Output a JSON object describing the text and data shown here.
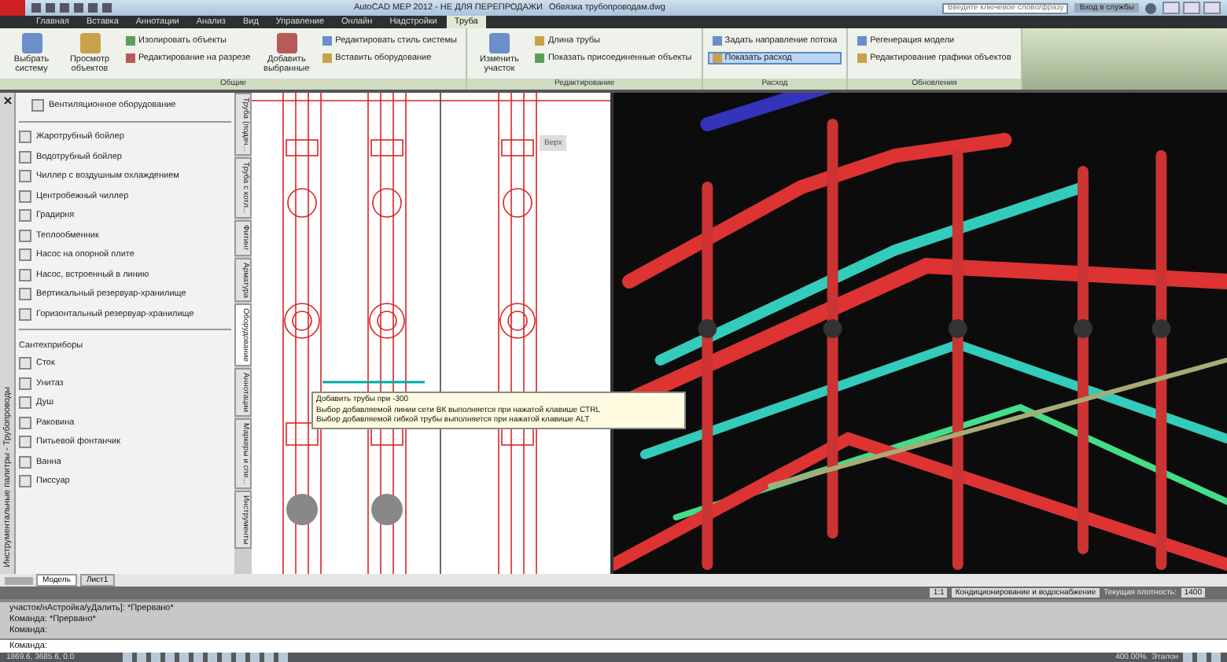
{
  "window": {
    "app_title": "AutoCAD MEP 2012 - НЕ ДЛЯ ПЕРЕПРОДАЖИ",
    "file_title": "Обвязка трубопроводам.dwg",
    "search": {
      "placeholder": "Введите ключевое слово/фразу"
    },
    "sign_in": "Вход в службы"
  },
  "tabs": [
    {
      "label": "Главная",
      "selected": false
    },
    {
      "label": "Вставка",
      "selected": false
    },
    {
      "label": "Аннотации",
      "selected": false
    },
    {
      "label": "Анализ",
      "selected": false
    },
    {
      "label": "Вид",
      "selected": false
    },
    {
      "label": "Управление",
      "selected": false
    },
    {
      "label": "Онлайн",
      "selected": false
    },
    {
      "label": "Надстройки",
      "selected": false
    },
    {
      "label": "Труба",
      "selected": true
    }
  ],
  "ribbon": {
    "panels": [
      {
        "title": "Общие",
        "groups": [
          {
            "kind": "large",
            "label": "Выбрать систему"
          },
          {
            "kind": "large",
            "label": "Просмотр объектов"
          },
          {
            "kind": "stack",
            "items": [
              {
                "label": "Изолировать объекты",
                "selected": false
              },
              {
                "label": "Редактирование на разрезе",
                "selected": false
              }
            ]
          },
          {
            "kind": "large",
            "label": "Добавить выбранные"
          },
          {
            "kind": "stack",
            "items": [
              {
                "label": "Редактировать стиль системы",
                "selected": false
              },
              {
                "label": "Вставить оборудование",
                "selected": false
              }
            ]
          }
        ]
      },
      {
        "title": "Редактирование",
        "groups": [
          {
            "kind": "large",
            "label": "Изменить участок"
          },
          {
            "kind": "stack",
            "items": [
              {
                "label": "Длина трубы",
                "selected": false
              },
              {
                "label": "Показать присоединенные объекты",
                "selected": false
              }
            ]
          }
        ]
      },
      {
        "title": "Расход",
        "groups": [
          {
            "kind": "stack",
            "items": [
              {
                "label": "Задать направление потока",
                "selected": false
              },
              {
                "label": "Показать расход",
                "selected": true
              }
            ]
          }
        ]
      },
      {
        "title": "Обновления",
        "groups": [
          {
            "kind": "stack",
            "items": [
              {
                "label": "Регенерация модели",
                "selected": false
              },
              {
                "label": "Редактирование графики объектов",
                "selected": false
              }
            ]
          }
        ]
      }
    ]
  },
  "palette": {
    "title": "Инструментальные палитры - Трубопроводы",
    "header_item": "Вентиляционное оборудование",
    "equipment": [
      "Жаротрубный бойлер",
      "Водотрубный бойлер",
      "Чиллер с воздушным охлаждением",
      "Центробежный чиллер",
      "Градирня",
      "Теплообменник",
      "Насос на опорной плите",
      "Насос, встроенный в линию",
      "Вертикальный резервуар-хранилище",
      "Горизонтальный резервуар-хранилище"
    ],
    "section_title": "Сантехприборы",
    "fixtures": [
      "Сток",
      "Унитаз",
      "Душ",
      "Раковина",
      "Питьевой фонтанчик",
      "Ванна",
      "Писсуар"
    ],
    "tabs": [
      {
        "label": "Труба (подач...",
        "selected": false
      },
      {
        "label": "Труба с котл...",
        "selected": false
      },
      {
        "label": "Фитинг",
        "selected": false
      },
      {
        "label": "Арматура",
        "selected": false
      },
      {
        "label": "Оборудование",
        "selected": true
      },
      {
        "label": "Аннотации",
        "selected": false
      },
      {
        "label": "Маркеры и спе...",
        "selected": false
      },
      {
        "label": "Инструменты",
        "selected": false
      }
    ]
  },
  "viewport": {
    "view_label": "Верх",
    "tooltip": [
      "Добавить трубы при -300",
      "Выбор добавляемой линии сети ВК выполняется при нажатой клавише CTRL",
      "Выбор добавляемой гибкой трубы выполняется при нажатой клавише ALT"
    ]
  },
  "layout_tabs": [
    {
      "label": "Модель",
      "selected": true
    },
    {
      "label": "Лист1",
      "selected": false
    }
  ],
  "drawing_status": {
    "scale": "1:1",
    "system": "Кондиционирование и водоснабжение",
    "density_label": "Текущая плотность:",
    "density": "1400"
  },
  "command_line": {
    "history": [
      "участок/нАстройка/уДалить]: *Прервано*",
      "Команда: *Прервано*",
      "Команда:"
    ],
    "prompt": "Команда:"
  },
  "status_bar": {
    "coordinates": "1869.6, 3685.6, 0.0",
    "zoom": "400.00%",
    "annotation": "Эталон"
  }
}
